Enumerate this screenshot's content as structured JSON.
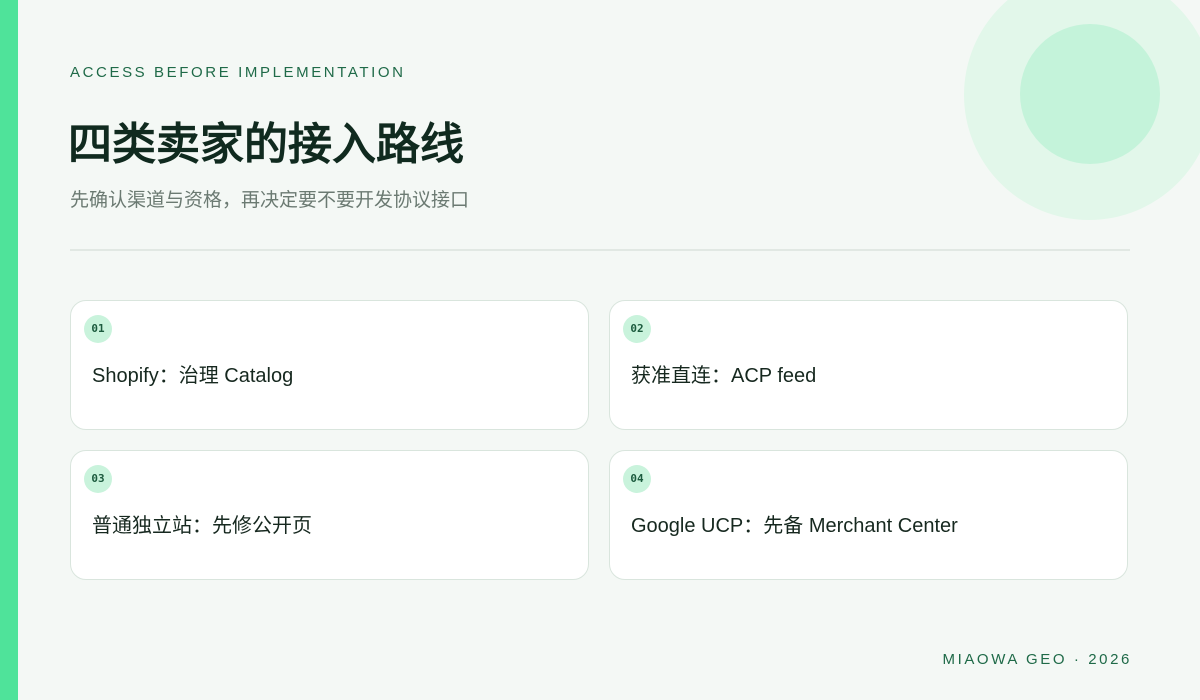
{
  "header": {
    "eyebrow": "ACCESS BEFORE IMPLEMENTATION",
    "title": "四类卖家的接入路线",
    "subtitle": "先确认渠道与资格，再决定要不要开发协议接口"
  },
  "cards": [
    {
      "number": "01",
      "text": "Shopify：治理 Catalog"
    },
    {
      "number": "02",
      "text": "获准直连：ACP feed"
    },
    {
      "number": "03",
      "text": "普通独立站：先修公开页"
    },
    {
      "number": "04",
      "text": "Google UCP：先备 Merchant Center"
    }
  ],
  "footer": {
    "text": "MIAOWA GEO · 2026"
  },
  "colors": {
    "accent": "#4fe39a",
    "badge_bg": "#c9f3dc",
    "title": "#102a1f",
    "eyebrow": "#1f6a48",
    "background": "#f4f8f5"
  }
}
